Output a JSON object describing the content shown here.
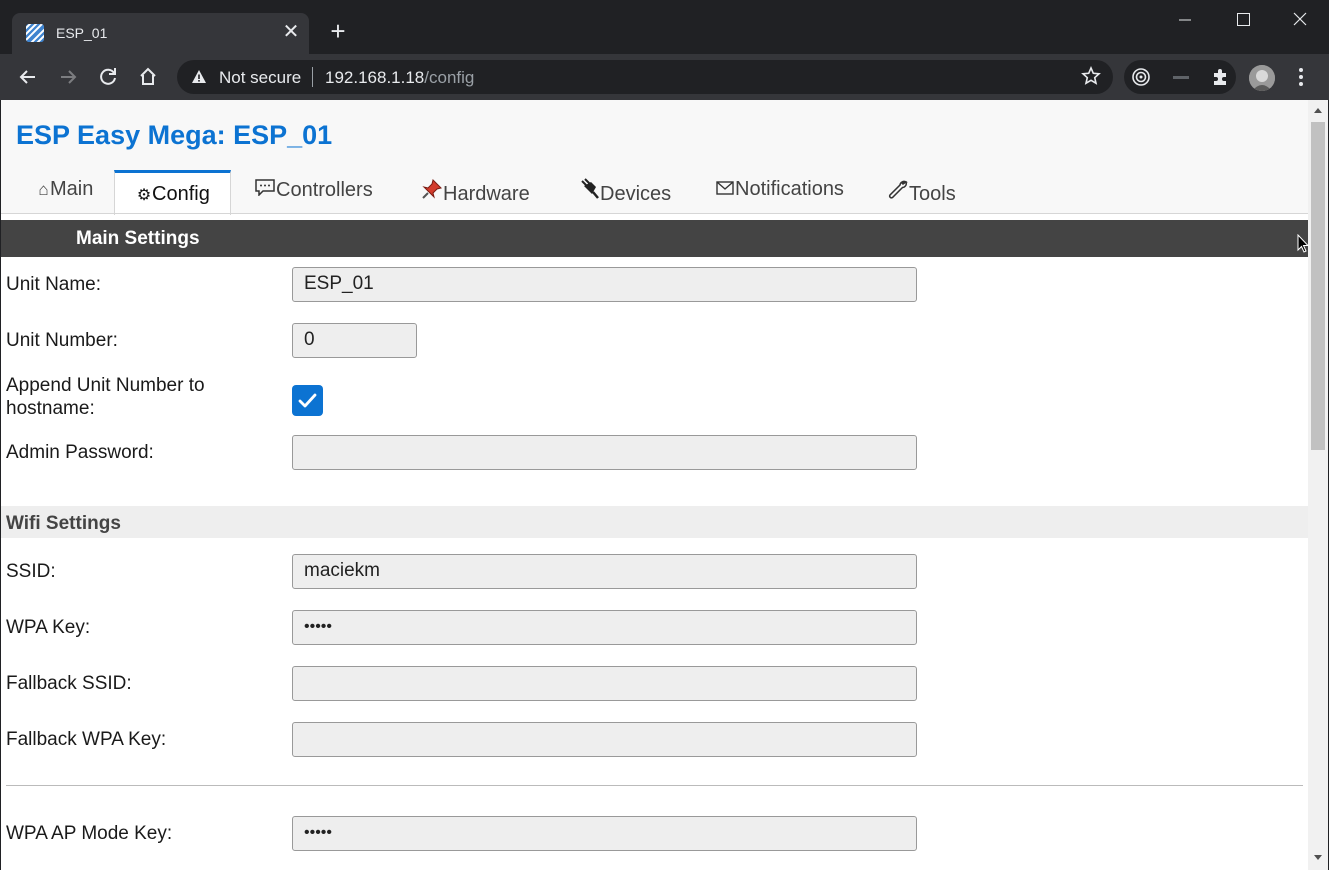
{
  "browser": {
    "tab_title": "ESP_01",
    "tab_close_glyph": "✕",
    "new_tab_glyph": "+",
    "window_controls": {
      "minimize": "—",
      "maximize": "☐",
      "close": "✕"
    },
    "security_label": "Not secure",
    "url_host": "192.168.1.18",
    "url_path": "/config",
    "icons": [
      "back-icon",
      "forward-icon",
      "reload-icon",
      "home-icon",
      "warning-icon",
      "star-icon",
      "extension-icon",
      "menu-icon"
    ]
  },
  "page": {
    "title": "ESP Easy Mega: ESP_01",
    "accent_color": "#0c73d2",
    "nav_tabs": [
      {
        "icon": "⌂",
        "label": "Main",
        "active": false
      },
      {
        "icon": "⚙",
        "label": "Config",
        "active": true
      },
      {
        "icon": "💬",
        "label": "Controllers",
        "active": false
      },
      {
        "icon": "📌",
        "label": "Hardware",
        "active": false
      },
      {
        "icon": "🔌",
        "label": "Devices",
        "active": false
      },
      {
        "icon": "✉",
        "label": "Notifications",
        "active": false
      },
      {
        "icon": "🔧",
        "label": "Tools",
        "active": false
      }
    ],
    "main_settings": {
      "heading": "Main Settings",
      "unit_name_label": "Unit Name:",
      "unit_name_value": "ESP_01",
      "unit_number_label": "Unit Number:",
      "unit_number_value": "0",
      "append_label_line1": "Append Unit Number to",
      "append_label_line2": "hostname:",
      "append_checked": true,
      "admin_password_label": "Admin Password:",
      "admin_password_value": ""
    },
    "wifi_settings": {
      "heading": "Wifi Settings",
      "ssid_label": "SSID:",
      "ssid_value": "maciekm",
      "wpa_key_label": "WPA Key:",
      "wpa_key_value": "•••••",
      "fallback_ssid_label": "Fallback SSID:",
      "fallback_ssid_value": "",
      "fallback_wpa_label": "Fallback WPA Key:",
      "fallback_wpa_value": "",
      "ap_key_label": "WPA AP Mode Key:",
      "ap_key_value": "•••••"
    }
  }
}
